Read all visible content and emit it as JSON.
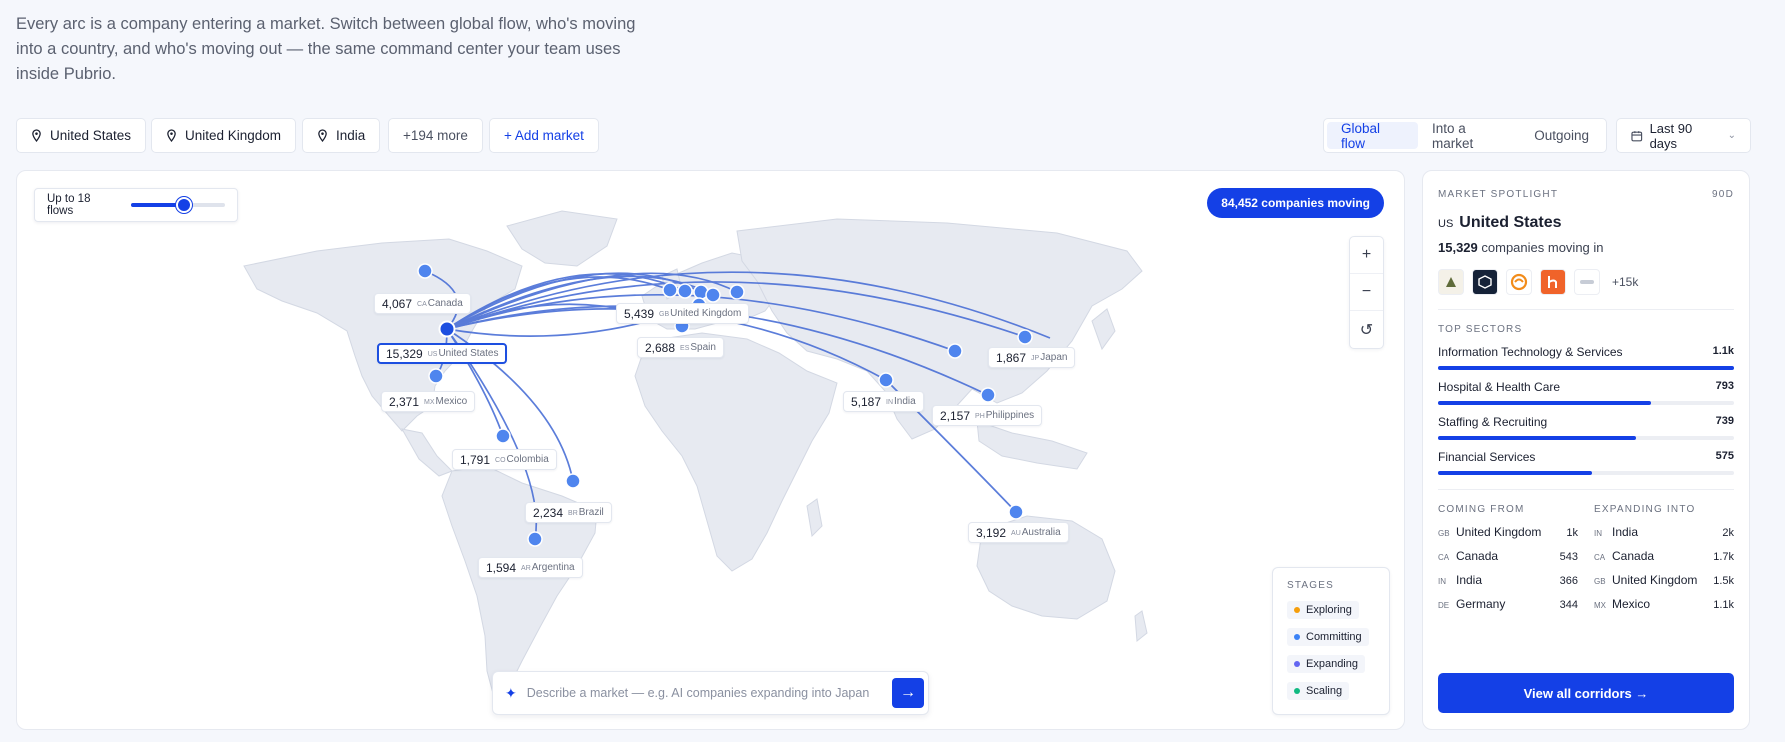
{
  "intro": "Every arc is a company entering a market. Switch between global flow, who's moving into a country, and who's moving out — the same command center your team uses inside Pubrio.",
  "markets": [
    "United States",
    "United Kingdom",
    "India"
  ],
  "more_markets": "+194 more",
  "add_market": "+ Add market",
  "view_modes": [
    "Global flow",
    "Into a market",
    "Outgoing"
  ],
  "active_view": "Global flow",
  "date_range": "Last 90 days",
  "flows_label": "Up to 18 flows",
  "flows_slider": {
    "value": 10,
    "max": 18
  },
  "moving_badge": "84,452 companies moving",
  "zoom": {
    "in": "+",
    "out": "−",
    "reset": "↺"
  },
  "map_labels": [
    {
      "count": "4,067",
      "code": "CA",
      "name": "Canada"
    },
    {
      "count": "15,329",
      "code": "US",
      "name": "United States"
    },
    {
      "count": "2,371",
      "code": "MX",
      "name": "Mexico"
    },
    {
      "count": "1,791",
      "code": "CO",
      "name": "Colombia"
    },
    {
      "count": "2,234",
      "code": "BR",
      "name": "Brazil"
    },
    {
      "count": "1,594",
      "code": "AR",
      "name": "Argentina"
    },
    {
      "count": "5,439",
      "code": "GB",
      "name": "United Kingdom"
    },
    {
      "count": "2,688",
      "code": "ES",
      "name": "Spain"
    },
    {
      "count": "5,187",
      "code": "IN",
      "name": "India"
    },
    {
      "count": "2,157",
      "code": "PH",
      "name": "Philippines"
    },
    {
      "count": "1,867",
      "code": "JP",
      "name": "Japan"
    },
    {
      "count": "3,192",
      "code": "AU",
      "name": "Australia"
    }
  ],
  "stages": {
    "title": "STAGES",
    "items": [
      {
        "label": "Exploring",
        "color": "#f59e0b"
      },
      {
        "label": "Committing",
        "color": "#3b82f6"
      },
      {
        "label": "Expanding",
        "color": "#6366f1"
      },
      {
        "label": "Scaling",
        "color": "#10b981"
      }
    ]
  },
  "ask": {
    "placeholder": "Describe a market — e.g. AI companies expanding into Japan",
    "submit": "→"
  },
  "spotlight": {
    "kicker": "MARKET SPOTLIGHT",
    "period": "90D",
    "code": "US",
    "country": "United States",
    "count": "15,329",
    "count_suffix": "companies moving in",
    "more_logos": "+15k",
    "sectors_title": "TOP SECTORS",
    "sectors": [
      {
        "name": "Information Technology & Services",
        "value": "1.1k",
        "share": 1.0
      },
      {
        "name": "Hospital & Health Care",
        "value": "793",
        "share": 0.72
      },
      {
        "name": "Staffing & Recruiting",
        "value": "739",
        "share": 0.67
      },
      {
        "name": "Financial Services",
        "value": "575",
        "share": 0.52
      }
    ],
    "coming_title": "COMING FROM",
    "coming": [
      {
        "code": "GB",
        "name": "United Kingdom",
        "value": "1k"
      },
      {
        "code": "CA",
        "name": "Canada",
        "value": "543"
      },
      {
        "code": "IN",
        "name": "India",
        "value": "366"
      },
      {
        "code": "DE",
        "name": "Germany",
        "value": "344"
      }
    ],
    "expanding_title": "EXPANDING INTO",
    "expanding": [
      {
        "code": "IN",
        "name": "India",
        "value": "2k"
      },
      {
        "code": "CA",
        "name": "Canada",
        "value": "1.7k"
      },
      {
        "code": "GB",
        "name": "United Kingdom",
        "value": "1.5k"
      },
      {
        "code": "MX",
        "name": "Mexico",
        "value": "1.1k"
      }
    ],
    "cta": "View all corridors →"
  },
  "colors": {
    "accent": "#1440e6",
    "arc": "#4a6fd6",
    "land": "#e7eaf1"
  }
}
